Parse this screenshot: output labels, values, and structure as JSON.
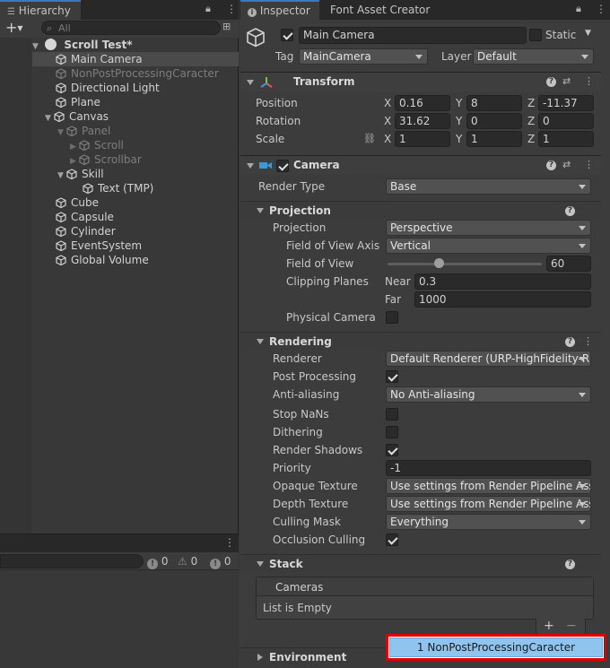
{
  "hierarchy": {
    "tab_label": "Hierarchy",
    "search_placeholder": "All",
    "scene_name": "Scroll Test*",
    "items": [
      {
        "label": "Main Camera"
      },
      {
        "label": "NonPostProcessingCaracter"
      },
      {
        "label": "Directional Light"
      },
      {
        "label": "Plane"
      },
      {
        "label": "Canvas"
      },
      {
        "label": "Panel"
      },
      {
        "label": "Scroll"
      },
      {
        "label": "Scrollbar"
      },
      {
        "label": "Skill"
      },
      {
        "label": "Text (TMP)"
      },
      {
        "label": "Cube"
      },
      {
        "label": "Capsule"
      },
      {
        "label": "Cylinder"
      },
      {
        "label": "EventSystem"
      },
      {
        "label": "Global Volume"
      }
    ]
  },
  "console": {
    "error_count": "0",
    "warning_count": "0",
    "info_count": "0"
  },
  "inspector": {
    "tabs": [
      "Inspector",
      "Font Asset Creator"
    ],
    "object_name": "Main Camera",
    "static_label": "Static",
    "tag_label": "Tag",
    "tag_value": "MainCamera",
    "layer_label": "Layer",
    "layer_value": "Default",
    "transform": {
      "title": "Transform",
      "position_label": "Position",
      "rotation_label": "Rotation",
      "scale_label": "Scale",
      "axes": [
        "X",
        "Y",
        "Z"
      ],
      "position": [
        "0.16",
        "8",
        "-11.37"
      ],
      "rotation": [
        "31.62",
        "0",
        "0"
      ],
      "scale": [
        "1",
        "1",
        "1"
      ]
    },
    "camera": {
      "title": "Camera",
      "render_type_label": "Render Type",
      "render_type_value": "Base",
      "projection_header": "Projection",
      "projection_label": "Projection",
      "projection_value": "Perspective",
      "fov_axis_label": "Field of View Axis",
      "fov_axis_value": "Vertical",
      "fov_label": "Field of View",
      "fov_value": "60",
      "fov_slider_fraction": 0.33,
      "clipping_label": "Clipping Planes",
      "near_label": "Near",
      "near_value": "0.3",
      "far_label": "Far",
      "far_value": "1000",
      "physical_label": "Physical Camera",
      "rendering_header": "Rendering",
      "renderer_label": "Renderer",
      "renderer_value": "Default Renderer (URP-HighFidelity-R",
      "post_label": "Post Processing",
      "aa_label": "Anti-aliasing",
      "aa_value": "No Anti-aliasing",
      "nans_label": "Stop NaNs",
      "dither_label": "Dithering",
      "shadows_label": "Render Shadows",
      "priority_label": "Priority",
      "priority_value": "-1",
      "opaque_label": "Opaque Texture",
      "opaque_value": "Use settings from Render Pipeline Ass",
      "depth_label": "Depth Texture",
      "depth_value": "Use settings from Render Pipeline Ass",
      "culling_label": "Culling Mask",
      "culling_value": "Everything",
      "occlusion_label": "Occlusion Culling",
      "stack_header": "Stack",
      "cameras_label": "Cameras",
      "list_empty": "List is Empty",
      "environment_header": "Environment"
    },
    "popup_item": "1  NonPostProcessingCaracter"
  },
  "colors": {
    "accent": "#3a79bb",
    "popup_bg": "#8fc4ef",
    "popup_border": "#e00000"
  }
}
